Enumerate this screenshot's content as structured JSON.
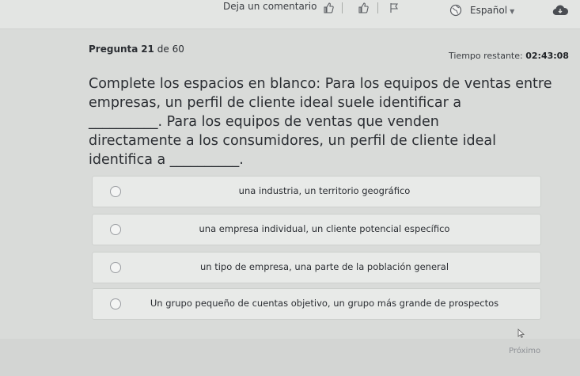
{
  "toolbar": {
    "feedback_label": "Deja un comentario",
    "language_label": "Español",
    "icons": [
      "thumbs-up-icon",
      "thumbs-up-outline-icon",
      "flag-icon",
      "globe-icon",
      "cloud-icon"
    ]
  },
  "question": {
    "number_prefix": "Pregunta",
    "number": "21",
    "of_label": "de",
    "total": "60",
    "timer_label": "Tiempo restante:",
    "timer_value": "02:43:08",
    "prompt_line1": "Complete los espacios en blanco: Para los equipos de ventas entre",
    "prompt_line2": "empresas, un perfil de cliente ideal suele identificar a",
    "prompt_line3": "__________. Para los equipos de ventas que venden",
    "prompt_line4": "directamente a los consumidores, un perfil de cliente ideal",
    "prompt_line5": "identifica a __________."
  },
  "options": [
    {
      "label": "una industria, un territorio geográfico"
    },
    {
      "label": "una empresa individual, un cliente potencial específico"
    },
    {
      "label": "un tipo de empresa, una parte de la población general"
    },
    {
      "label": "Un grupo pequeño de cuentas objetivo, un grupo más grande de prospectos"
    }
  ],
  "footer": {
    "next_label": "Próximo"
  },
  "colors": {
    "background": "#d9dbd9",
    "option_bg": "#e8eae8",
    "text": "#2b2e33"
  }
}
